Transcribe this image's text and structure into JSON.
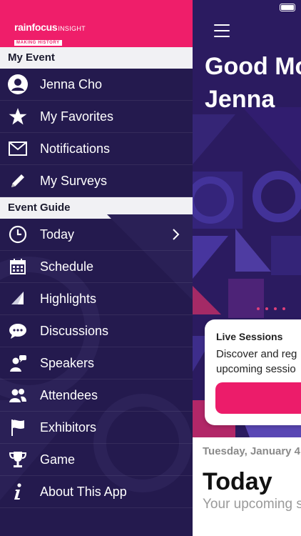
{
  "drawer": {
    "logo": {
      "brand": "rainfocus",
      "suffix": "INSIGHT",
      "tagline": "MAKING HISTORY"
    },
    "sections": [
      {
        "title": "My Event",
        "items": [
          {
            "label": "Jenna Cho",
            "icon": "user-avatar-icon"
          },
          {
            "label": "My Favorites",
            "icon": "star-icon"
          },
          {
            "label": "Notifications",
            "icon": "envelope-icon"
          },
          {
            "label": "My Surveys",
            "icon": "pencil-icon"
          }
        ]
      },
      {
        "title": "Event Guide",
        "items": [
          {
            "label": "Today",
            "icon": "clock-icon"
          },
          {
            "label": "Schedule",
            "icon": "calendar-icon"
          },
          {
            "label": "Highlights",
            "icon": "sail-icon"
          },
          {
            "label": "Discussions",
            "icon": "chat-bubble-icon"
          },
          {
            "label": "Speakers",
            "icon": "speaker-icon"
          },
          {
            "label": "Attendees",
            "icon": "people-icon"
          },
          {
            "label": "Exhibitors",
            "icon": "flag-icon"
          },
          {
            "label": "Game",
            "icon": "trophy-icon"
          },
          {
            "label": "About This App",
            "icon": "info-icon"
          }
        ]
      }
    ],
    "colors": {
      "header": "#ef1e6a",
      "background": "#241a4e",
      "section": "#f1f1f4"
    }
  },
  "main": {
    "greeting": "Good Mo… Jenna",
    "greeting_line1": "Good Mo",
    "greeting_line2": "Jenna",
    "live_sessions": {
      "title": "Live Sessions",
      "description_line1": "Discover and reg",
      "description_line2": "upcoming sessio"
    },
    "date_label": "Tuesday, January 4",
    "today_heading": "Today",
    "today_subtitle": "Your upcoming s",
    "colors": {
      "accent": "#ec1c6a"
    }
  }
}
